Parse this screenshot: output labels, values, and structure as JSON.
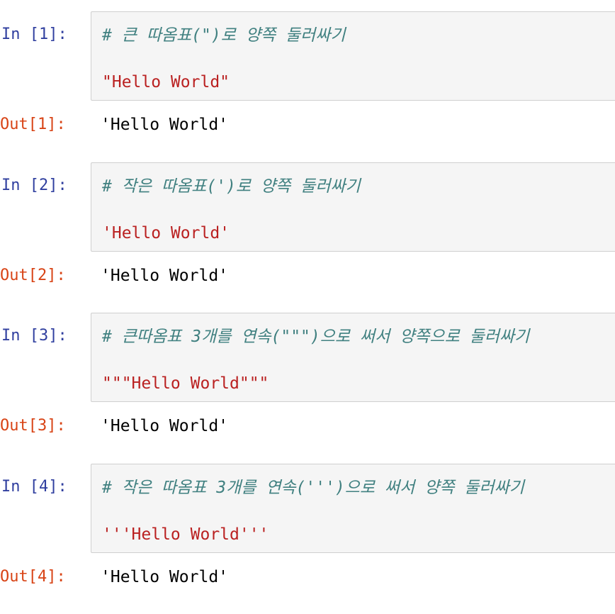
{
  "cells": [
    {
      "in_prompt": "In [1]:",
      "comment": "# 큰 따옴표(\")로 양쪽 둘러싸기",
      "code": "\"Hello World\"",
      "out_prompt": "Out[1]:",
      "output": "'Hello World'"
    },
    {
      "in_prompt": "In [2]:",
      "comment": "# 작은 따옴표(')로 양쪽 둘러싸기",
      "code": "'Hello World'",
      "out_prompt": "Out[2]:",
      "output": "'Hello World'"
    },
    {
      "in_prompt": "In [3]:",
      "comment": "# 큰따옴표 3개를 연속(\"\"\")으로 써서 양쪽으로 둘러싸기",
      "code": "\"\"\"Hello World\"\"\"",
      "out_prompt": "Out[3]:",
      "output": "'Hello World'"
    },
    {
      "in_prompt": "In [4]:",
      "comment": "# 작은 따옴표 3개를 연속(''')으로 써서 양쪽 둘러싸기",
      "code": "'''Hello World'''",
      "out_prompt": "Out[4]:",
      "output": "'Hello World'"
    }
  ],
  "colors": {
    "in_prompt": "#303f9f",
    "out_prompt": "#d84315",
    "comment": "#408080",
    "string": "#ba2121",
    "cell_bg": "#f5f5f5",
    "cell_border": "#cfcfcf"
  }
}
